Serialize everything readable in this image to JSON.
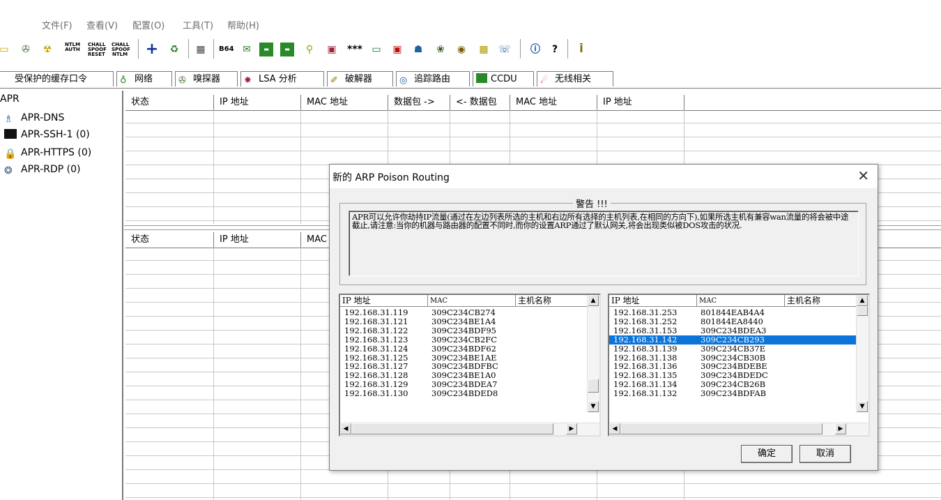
{
  "menu": [
    "文件(F)",
    "查看(V)",
    "配置(O)",
    "工具(T)",
    "帮助(H)"
  ],
  "toolbar": {
    "ntlm_auth": "NTLM AUTH",
    "chall_spoof_reset": "CHALL SPOOF RESET",
    "chall_spoof_ntlm": "CHALL SPOOF NTLM",
    "b64": "B64"
  },
  "tabs": [
    "受保护的缓存口令",
    "网络",
    "嗅探器",
    "LSA 分析",
    "破解器",
    "追踪路由",
    "CCDU",
    "无线相关"
  ],
  "tree": {
    "root": "APR",
    "items": [
      "APR-DNS",
      "APR-SSH-1 (0)",
      "APR-HTTPS (0)",
      "APR-RDP (0)"
    ]
  },
  "grid1": {
    "headers": [
      "状态",
      "IP 地址",
      "MAC 地址",
      "数据包 ->",
      "<- 数据包",
      "MAC 地址",
      "IP 地址"
    ]
  },
  "grid2": {
    "headers": [
      "状态",
      "IP 地址",
      "MAC"
    ]
  },
  "dialog": {
    "title": "新的 ARP Poison Routing",
    "warning_title": "警告 !!!",
    "warning_text": "APR可以允许你劫持IP流量(通过在左边列表所选的主机和右边所有选择的主机列表,在相同的方向下),如果所选主机有兼容wan流量的将会被中途截止,请注意:当你的机器与路由器的配置不同时,而你的设置ARP通过了默认网关,将会出现类似被DOS攻击的状况.",
    "left_list": {
      "headers": [
        "IP 地址",
        "MAC",
        "主机名称"
      ],
      "rows": [
        [
          "192.168.31.119",
          "309C234CB274",
          ""
        ],
        [
          "192.168.31.121",
          "309C234BE1A4",
          ""
        ],
        [
          "192.168.31.122",
          "309C234BDF95",
          ""
        ],
        [
          "192.168.31.123",
          "309C234CB2FC",
          ""
        ],
        [
          "192.168.31.124",
          "309C234BDF62",
          ""
        ],
        [
          "192.168.31.125",
          "309C234BE1AE",
          ""
        ],
        [
          "192.168.31.127",
          "309C234BDFBC",
          ""
        ],
        [
          "192.168.31.128",
          "309C234BE1A0",
          ""
        ],
        [
          "192.168.31.129",
          "309C234BDEA7",
          ""
        ],
        [
          "192.168.31.130",
          "309C234BDED8",
          ""
        ]
      ]
    },
    "right_list": {
      "headers": [
        "IP 地址",
        "MAC",
        "主机名称"
      ],
      "rows": [
        [
          "192.168.31.253",
          "801844EAB4A4",
          ""
        ],
        [
          "192.168.31.252",
          "801844EA8440",
          ""
        ],
        [
          "192.168.31.153",
          "309C234BDEA3",
          ""
        ],
        [
          "192.168.31.142",
          "309C234CB293",
          ""
        ],
        [
          "192.168.31.139",
          "309C234CB37E",
          ""
        ],
        [
          "192.168.31.138",
          "309C234CB30B",
          ""
        ],
        [
          "192.168.31.136",
          "309C234BDEBE",
          ""
        ],
        [
          "192.168.31.135",
          "309C234BDEDC",
          ""
        ],
        [
          "192.168.31.134",
          "309C234CB26B",
          ""
        ],
        [
          "192.168.31.132",
          "309C234BDFAB",
          ""
        ]
      ],
      "selected_index": 3
    },
    "ok_label": "确定",
    "cancel_label": "取消",
    "close_glyph": "✕"
  },
  "colors": {
    "selection": "#0a74d8",
    "grid_line": "#c8c8c8"
  }
}
